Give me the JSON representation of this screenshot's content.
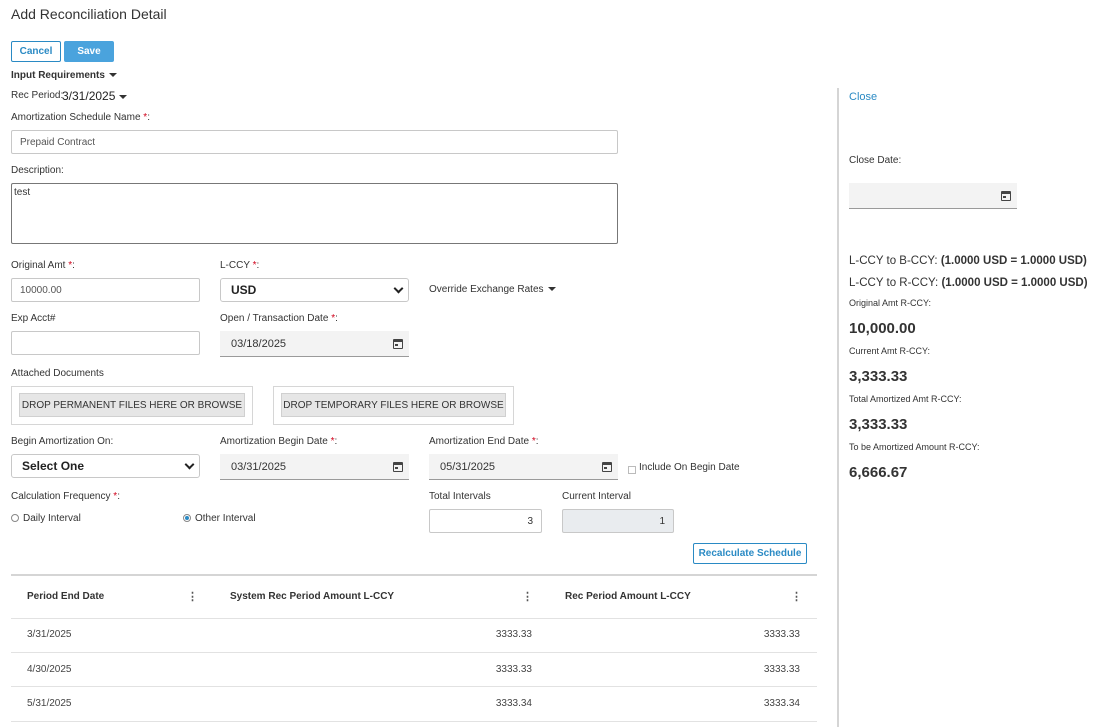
{
  "header": {
    "title": "Add Reconciliation Detail"
  },
  "toolbar": {
    "cancel_label": "Cancel",
    "save_label": "Save"
  },
  "input_requirements": {
    "label": "Input Requirements"
  },
  "rec_period": {
    "label": "Rec Period:",
    "value": "3/31/2025"
  },
  "schedule_name": {
    "label": "Amortization Schedule Name",
    "required_mark": "*",
    "colon": ":",
    "value": "Prepaid Contract"
  },
  "description": {
    "label": "Description:",
    "value": "test"
  },
  "original_amt": {
    "label": "Original Amt",
    "required_mark": "*",
    "colon": ":",
    "value": "10000.00"
  },
  "lccy": {
    "label": "L-CCY",
    "required_mark": "*",
    "colon": ":",
    "value": "USD"
  },
  "override_rates": {
    "label": "Override Exchange Rates"
  },
  "exp_acct": {
    "label": "Exp Acct#",
    "value": ""
  },
  "open_date": {
    "label": "Open / Transaction Date",
    "required_mark": "*",
    "colon": ":",
    "value": "03/18/2025"
  },
  "attached": {
    "label": "Attached Documents",
    "permanent_label": "DROP PERMANENT FILES HERE OR BROWSE",
    "temporary_label": "DROP TEMPORARY FILES HERE OR BROWSE"
  },
  "begin_on": {
    "label": "Begin Amortization On:",
    "value": "Select One"
  },
  "begin_date": {
    "label": "Amortization Begin Date",
    "required_mark": "*",
    "colon": ":",
    "value": "03/31/2025"
  },
  "end_date": {
    "label": "Amortization End Date",
    "required_mark": "*",
    "colon": ":",
    "value": "05/31/2025"
  },
  "include_begin": {
    "label": "Include On Begin Date",
    "checked": false
  },
  "calc_freq": {
    "label": "Calculation Frequency",
    "required_mark": "*",
    "colon": ":",
    "daily_label": "Daily Interval",
    "other_label": "Other Interval",
    "selected": "Other Interval"
  },
  "total_intervals": {
    "label": "Total Intervals",
    "value": "3"
  },
  "current_interval": {
    "label": "Current Interval",
    "value": "1"
  },
  "recalc": {
    "label": "Recalculate Schedule"
  },
  "table": {
    "columns": [
      "Period End Date",
      "System Rec Period Amount L-CCY",
      "Rec Period Amount L-CCY"
    ],
    "menu_glyph": "⋮",
    "rows": [
      {
        "date": "3/31/2025",
        "system": "3333.33",
        "rec": "3333.33"
      },
      {
        "date": "4/30/2025",
        "system": "3333.33",
        "rec": "3333.33"
      },
      {
        "date": "5/31/2025",
        "system": "3333.34",
        "rec": "3333.34"
      }
    ]
  },
  "side": {
    "close_link": "Close",
    "close_date_label": "Close Date:",
    "close_date_value": "",
    "lccy_bccy_label": "L-CCY to B-CCY:",
    "lccy_bccy_value": "(1.0000 USD = 1.0000 USD)",
    "lccy_rccy_label": "L-CCY to R-CCY:",
    "lccy_rccy_value": "(1.0000 USD = 1.0000 USD)",
    "orig_label": "Original Amt R-CCY:",
    "orig_value": "10,000.00",
    "current_label": "Current Amt R-CCY:",
    "current_value": "3,333.33",
    "total_label": "Total Amortized Amt R-CCY:",
    "total_value": "3,333.33",
    "tobe_label": "To be Amortized Amount R-CCY:",
    "tobe_value": "6,666.67"
  },
  "colors": {
    "accent": "#2a8ac4",
    "primary_button": "#4aa3dd",
    "required": "#d0021b"
  }
}
